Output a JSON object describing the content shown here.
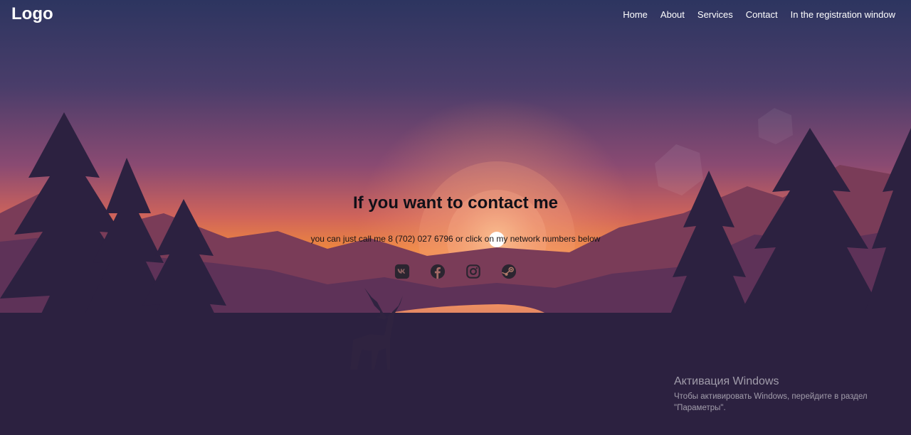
{
  "header": {
    "logo": "Logo",
    "nav": [
      "Home",
      "About",
      "Services",
      "Contact",
      "In the registration window"
    ]
  },
  "hero": {
    "title": "If you want to contact me",
    "text": "you can just call me 8 (702) 027 6796 or click on my network numbers below"
  },
  "socials": [
    {
      "icon": "vk-icon"
    },
    {
      "icon": "facebook-icon"
    },
    {
      "icon": "instagram-icon"
    },
    {
      "icon": "steam-icon"
    }
  ],
  "windows_activation": {
    "title": "Активация Windows",
    "text_line1": "Чтобы активировать Windows, перейдите в раздел",
    "text_line2": "\"Параметры\"."
  },
  "colors": {
    "sky_top": "#2d3560",
    "sky_mid": "#8a4a72",
    "horizon": "#f08a3c",
    "sun": "#ffffff",
    "silhouette": "#2c2140",
    "icon": "#2b2530"
  }
}
